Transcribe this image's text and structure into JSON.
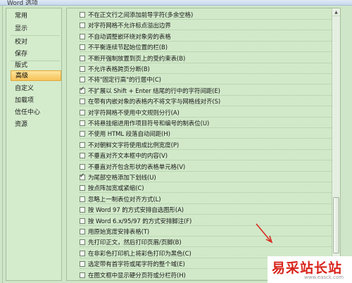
{
  "window": {
    "title": "Word 选项"
  },
  "sidebar": {
    "items": [
      {
        "label": "常用"
      },
      {
        "label": "显示"
      },
      {
        "label": "校对"
      },
      {
        "label": "保存"
      },
      {
        "label": "版式"
      },
      {
        "label": "高级",
        "active": true
      },
      {
        "label": "自定义"
      },
      {
        "label": "加载项"
      },
      {
        "label": "信任中心"
      },
      {
        "label": "资源"
      }
    ]
  },
  "options": [
    {
      "label": "不在正文行之间添加前导字符(多余空格)",
      "checked": false
    },
    {
      "label": "对字符网格不允许标点溢出边界",
      "checked": false
    },
    {
      "label": "不自动调整嵌环绕对象旁的表格",
      "checked": false
    },
    {
      "label": "不平衡连续节起始位置的栏(B)",
      "checked": false
    },
    {
      "label": "不断开强制放置到页上的受约束表(B)",
      "checked": false
    },
    {
      "label": "不允许表格跨页分断(B)",
      "checked": false
    },
    {
      "label": "不将\"固定行高\"的行居中(C)",
      "checked": false
    },
    {
      "label": "不扩展以 Shift + Enter 结尾的行中的字符间距(E)",
      "checked": true
    },
    {
      "label": "在带有内嵌对象的表格内不将文字与网格线对齐(S)",
      "checked": false
    },
    {
      "label": "对字符网格不使用中文规则分行(A)",
      "checked": false
    },
    {
      "label": "不将悬挂缩进用作项目符号和编号的制表位(U)",
      "checked": false
    },
    {
      "label": "不使用 HTML 段落自动间距(H)",
      "checked": false
    },
    {
      "label": "不对朝鲜文字符使用成比例宽度(P)",
      "checked": false
    },
    {
      "label": "不垂直对齐文本框中的内容(V)",
      "checked": false
    },
    {
      "label": "不垂直对齐包含形状的表格单元格(V)",
      "checked": false
    },
    {
      "label": "为尾部空格添加下划线(U)",
      "checked": true
    },
    {
      "label": "按点阵加宽或紧缩(C)",
      "checked": false
    },
    {
      "label": "忽略上一制表位对齐方式(L)",
      "checked": false
    },
    {
      "label": "按 Word 97 的方式安排自选图形(A)",
      "checked": false
    },
    {
      "label": "按 Word 6.x/95/97 的方式安排脚注(F)",
      "checked": false
    },
    {
      "label": "用原始宽度安排表格(T)",
      "checked": false
    },
    {
      "label": "先打印正文，然后打印页眉/页脚(B)",
      "checked": false
    },
    {
      "label": "在非彩色打印机上将彩色打印为黑色(C)",
      "checked": false
    },
    {
      "label": "选定带有首字符或尾字符的整个域(E)",
      "checked": false
    },
    {
      "label": "在图文框中显示硬分页符或分栏符(H)",
      "checked": false
    }
  ],
  "watermark": {
    "text": "易采站长站",
    "url": "www.easck.com"
  },
  "colors": {
    "background": "#cfe6c8",
    "active_nav": "#f7c25b",
    "watermark": "#d8251c"
  }
}
